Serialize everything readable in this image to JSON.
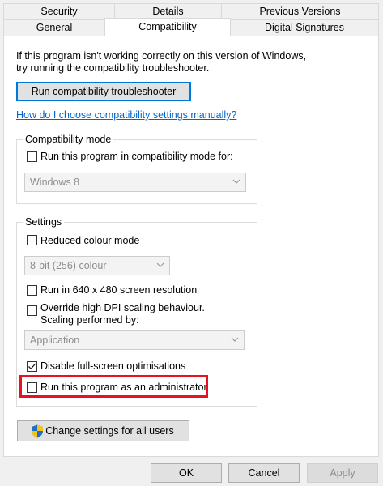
{
  "tabs_row1": [
    "Security",
    "Details",
    "Previous Versions"
  ],
  "tabs_row2": [
    "General",
    "Compatibility",
    "Digital Signatures"
  ],
  "intro": {
    "line1": "If this program isn't working correctly on this version of Windows,",
    "line2": "try running the compatibility troubleshooter."
  },
  "troubleshooter_button": "Run compatibility troubleshooter",
  "help_link": "How do I choose compatibility settings manually?",
  "compat_mode": {
    "title": "Compatibility mode",
    "checkbox_label": "Run this program in compatibility mode for:",
    "checked": false,
    "select_value": "Windows 8"
  },
  "settings": {
    "title": "Settings",
    "reduced_colour": {
      "label": "Reduced colour mode",
      "checked": false
    },
    "colour_select": "8-bit (256) colour",
    "res640": {
      "label": "Run in 640 x 480 screen resolution",
      "checked": false
    },
    "dpi": {
      "label_line1": "Override high DPI scaling behaviour.",
      "label_line2": "Scaling performed by:",
      "checked": false
    },
    "dpi_select": "Application",
    "fullscreen": {
      "label": "Disable full-screen optimisations",
      "checked": true
    },
    "admin": {
      "label": "Run this program as an administrator",
      "checked": false
    }
  },
  "change_all_button": "Change settings for all users",
  "footer": {
    "ok": "OK",
    "cancel": "Cancel",
    "apply": "Apply"
  },
  "colors": {
    "highlight": "#e81123",
    "focus": "#0078d7",
    "link": "#0066cc"
  },
  "icons": [
    "shield-icon",
    "checkmark-icon",
    "chevron-down-icon"
  ]
}
